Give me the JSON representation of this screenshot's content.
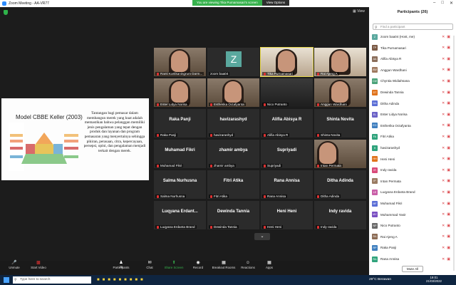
{
  "titlebar": {
    "title": "Zoom Meeting - AA-VR77",
    "banner": "You are viewing Tika Purnamasari's screen",
    "view_options": "View Options"
  },
  "view_button": "View",
  "slide": {
    "title": "Model CBBE Keller (2003)",
    "text": "Tantangan bagi pemasar dalam membangun merek yang kuat adalah memastikan bahwa pelanggan memiliki jenis pengalaman yang tepat dengan produk dan layanan dan program pemasaran yang menyertainya sehingga pikiran, perasaan, citra, kepercayaan, persepsi, opini, dan pengalaman menjadi terkait dengan merek."
  },
  "tiles": [
    {
      "name": "Ranti Kartikaningrum Darm...",
      "type": "photo"
    },
    {
      "name": "zoom baa04",
      "type": "avatar",
      "letter": "Z"
    },
    {
      "name": "Tika Purnamasari",
      "type": "photo-highlight"
    },
    {
      "name": "Rai Ajeng A",
      "type": "photo-bright"
    },
    {
      "name": "Ester Lidya Norisa",
      "type": "photo"
    },
    {
      "name": "Estherika Octafyanta",
      "type": "photo"
    },
    {
      "name": "Nico Putranto",
      "type": "photo-dark"
    },
    {
      "name": "Anggun Wardhani",
      "type": "photo"
    },
    {
      "name": "Raka Panji",
      "center": "Raka Panji"
    },
    {
      "name": "havizarashyd",
      "center": "havizarashyd"
    },
    {
      "name": "Alifia Abisya R",
      "center": "Alifia Abisya R"
    },
    {
      "name": "Shinta Novita",
      "center": "Shinta Novita"
    },
    {
      "name": "Muhamad Fikri",
      "center": "Muhamad Fikri"
    },
    {
      "name": "zhamir ambya",
      "center": "zhamir ambya"
    },
    {
      "name": "Supriyadi",
      "center": "Supriyadi"
    },
    {
      "name": "Intan Permata",
      "type": "photo"
    },
    {
      "name": "Salma Nurhusna",
      "center": "Salma Nurhusna"
    },
    {
      "name": "Fitri Atika",
      "center": "Fitri Atika"
    },
    {
      "name": "Rana Annisa",
      "center": "Rana Annisa"
    },
    {
      "name": "Ditha Adinda",
      "center": "Ditha Adinda"
    },
    {
      "name": "Luqyana Erdanta Brand",
      "center": "Luqyana Erdant..."
    },
    {
      "name": "Dewinda Tannia",
      "center": "Dewinda Tannia"
    },
    {
      "name": "Heni Heni",
      "center": "Heni Heni"
    },
    {
      "name": "Indy ravida",
      "center": "Indy ravida"
    }
  ],
  "participants": {
    "header": "Participants (26)",
    "search_placeholder": "Find a participant",
    "items": [
      {
        "name": "zoom baa04 (Host, me)",
        "initials": "Z",
        "color": "#5aa89e"
      },
      {
        "name": "Tika Purnamasari",
        "initials": "TP",
        "color": "#7b5a45"
      },
      {
        "name": "Alifia Abisya R",
        "initials": "AA",
        "color": "#8a6d5a"
      },
      {
        "name": "Anggun Wardhani",
        "initials": "AW",
        "color": "#a07a60"
      },
      {
        "name": "Chyntia Widiahsana",
        "initials": "CW",
        "color": "#4ba37a"
      },
      {
        "name": "Dewinda Tannia",
        "initials": "DT",
        "color": "#e0731c"
      },
      {
        "name": "Ditha Adinda",
        "initials": "DA",
        "color": "#5b6ed6"
      },
      {
        "name": "Ester Lidya Norisa",
        "initials": "EL",
        "color": "#6c63c7"
      },
      {
        "name": "Estherika Octafyanta",
        "initials": "EO",
        "color": "#3f7fbf"
      },
      {
        "name": "Fitri Atika",
        "initials": "FA",
        "color": "#2fa37c"
      },
      {
        "name": "havizarashyd",
        "initials": "H",
        "color": "#2fa37c"
      },
      {
        "name": "Heni Heni",
        "initials": "HH",
        "color": "#e0731c"
      },
      {
        "name": "Indy ravida",
        "initials": "IR",
        "color": "#d94a7a"
      },
      {
        "name": "Intan Permata",
        "initials": "IP",
        "color": "#9a7b62"
      },
      {
        "name": "Luqyana Erdanta Brand",
        "initials": "LE",
        "color": "#c95fa8"
      },
      {
        "name": "Muhamad Fikri",
        "initials": "MF",
        "color": "#5b6ed6"
      },
      {
        "name": "Muhammad Yasir",
        "initials": "MY",
        "color": "#7a4fc2"
      },
      {
        "name": "Nico Putranto",
        "initials": "NP",
        "color": "#6a6a6a"
      },
      {
        "name": "Rai Ajeng A",
        "initials": "RA",
        "color": "#8c6c55"
      },
      {
        "name": "Raka Panji",
        "initials": "RP",
        "color": "#3f7fbf"
      },
      {
        "name": "Rana Annisa",
        "initials": "RA",
        "color": "#2fa37c"
      }
    ],
    "mute_all": "Mute All"
  },
  "toolbar": {
    "unmute": "Unmute",
    "start_video": "Start Video",
    "participants": "Participants",
    "participants_count": "26",
    "chat": "Chat",
    "share_screen": "Share Screen",
    "record": "Record",
    "breakout": "Breakout Rooms",
    "reactions": "Reactions",
    "apps": "Apps",
    "leave": "Leave Room"
  },
  "taskbar": {
    "search": "Type here to search",
    "weather": "29°C Berawan",
    "time": "19:01",
    "date": "21/03/2022"
  }
}
